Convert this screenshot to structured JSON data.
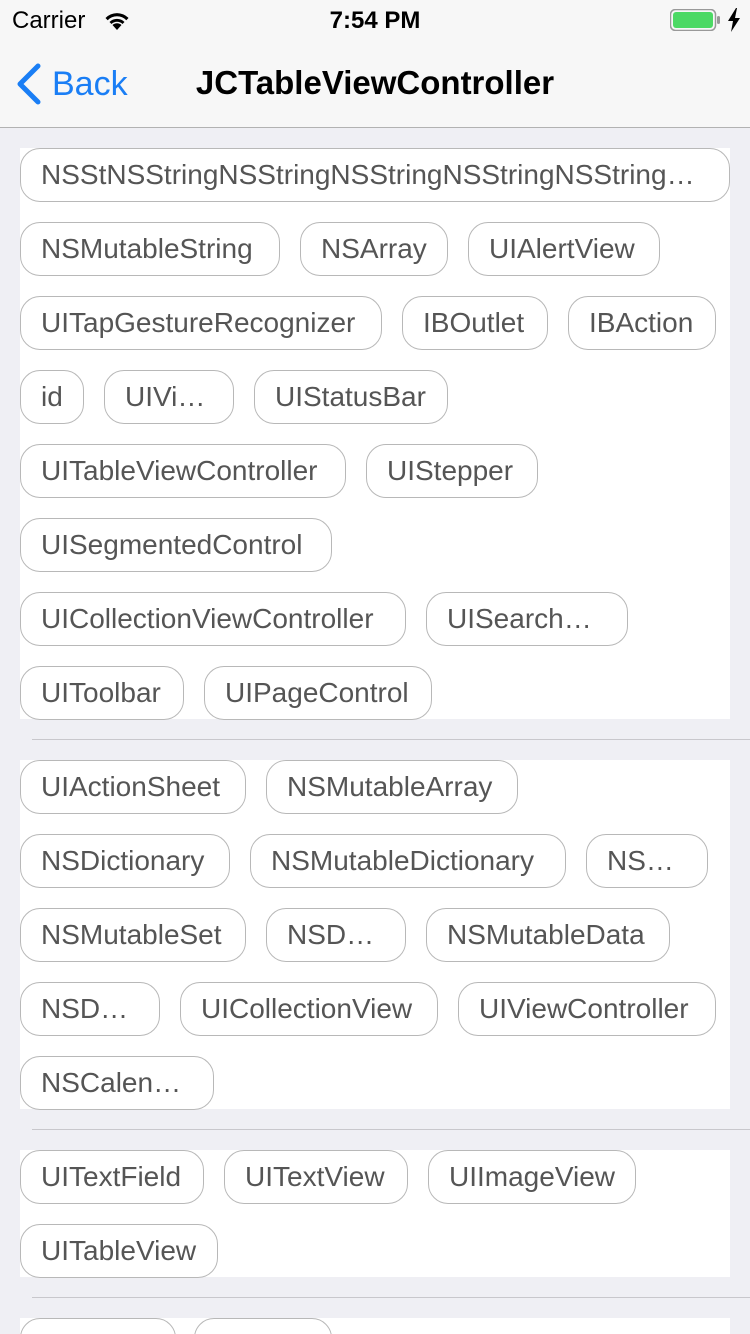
{
  "status_bar": {
    "carrier": "Carrier",
    "time": "7:54 PM"
  },
  "nav": {
    "back_label": "Back",
    "title": "JCTableViewController"
  },
  "sections": [
    {
      "tags": [
        "NSStNSStringNSStringNSStringNSStringNSStringNSString",
        "NSMutableString",
        "NSArray",
        "UIAlertView",
        "UITapGestureRecognizer",
        "IBOutlet",
        "IBAction",
        "id",
        "UIView",
        "UIStatusBar",
        "UITableViewController",
        "UIStepper",
        "UISegmentedControl",
        "UICollectionViewController",
        "UISearchBar",
        "UIToolbar",
        "UIPageControl"
      ]
    },
    {
      "tags": [
        "UIActionSheet",
        "NSMutableArray",
        "NSDictionary",
        "NSMutableDictionary",
        "NSSet",
        "NSMutableSet",
        "NSData",
        "NSMutableData",
        "NSDate",
        "UICollectionView",
        "UIViewController",
        "NSCalendar"
      ]
    },
    {
      "tags": [
        "UITextField",
        "UITextView",
        "UIImageView",
        "UITableView"
      ]
    },
    {
      "tags": [
        "",
        ""
      ]
    }
  ],
  "colors": {
    "accent": "#1a7ef5",
    "battery": "#4cd964",
    "tag_border": "#b8b8b8",
    "tag_text": "#555555"
  }
}
